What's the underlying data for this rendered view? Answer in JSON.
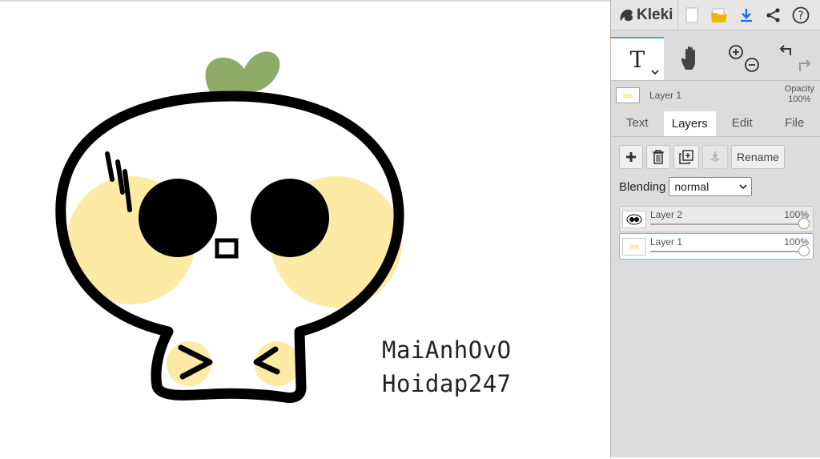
{
  "app": {
    "logo_text": "Kleki"
  },
  "canvas": {
    "watermark_lines": [
      "MaiAnhOvO",
      "Hoidap247"
    ]
  },
  "toolbar": {
    "icons": [
      "new-image-icon",
      "open-folder-icon",
      "download-icon",
      "share-icon",
      "help-icon"
    ]
  },
  "tools": {
    "active": "text",
    "text_tool_glyph": "T",
    "items": [
      "text-tool",
      "hand-tool",
      "zoom-tools",
      "undo-redo"
    ]
  },
  "layer_indicator": {
    "name": "Layer 1",
    "opacity_label": "Opacity",
    "opacity_value": "100%"
  },
  "tabs": [
    {
      "label": "Text",
      "active": false
    },
    {
      "label": "Layers",
      "active": true
    },
    {
      "label": "Edit",
      "active": false
    },
    {
      "label": "File",
      "active": false
    }
  ],
  "layer_actions": {
    "rename_label": "Rename"
  },
  "blending": {
    "label": "Blending",
    "value": "normal"
  },
  "layers": [
    {
      "name": "Layer 2",
      "opacity": "100%",
      "active": false
    },
    {
      "name": "Layer 1",
      "opacity": "100%",
      "active": true
    }
  ],
  "colors": {
    "accent": "#5b9bd5",
    "sprout": "#8fab68",
    "cheek": "#fdeaa5",
    "ink": "#000000"
  }
}
